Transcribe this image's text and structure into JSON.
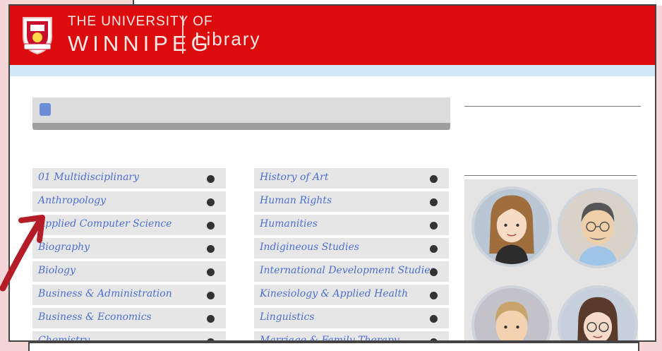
{
  "header": {
    "brand_line1": "THE UNIVERSITY OF",
    "brand_line2": "WINNIPEG",
    "brand_library": "Library",
    "color": "#dc0c0c"
  },
  "breadcrumb": {
    "text": ""
  },
  "search": {
    "active_tab": "",
    "tabs": [
      "",
      "",
      ""
    ]
  },
  "subjects_heading": "",
  "subjects_left": [
    "01 Multidisciplinary",
    "Anthropology",
    "Applied Computer Science",
    "Biography",
    "Biology",
    "Business & Administration",
    "Business & Economics",
    "Chemistry"
  ],
  "subjects_right": [
    "History of Art",
    "Human Rights",
    "Humanities",
    "Indigineous Studies",
    "International Development Studies",
    "Kinesiology & Applied Health",
    "Linguistics",
    "Marriage & Family Therapy"
  ],
  "sidebar": {
    "news_title": "",
    "news_text": "",
    "librarians_title": "",
    "librarians": [
      {
        "name": "",
        "icon": "librarian-avatar-1"
      },
      {
        "name": "",
        "icon": "librarian-avatar-2"
      },
      {
        "name": "",
        "icon": "librarian-avatar-3"
      },
      {
        "name": "",
        "icon": "librarian-avatar-4"
      }
    ]
  },
  "annotation": {
    "icon": "hand-drawn-arrow-icon",
    "color": "#b41c28"
  }
}
